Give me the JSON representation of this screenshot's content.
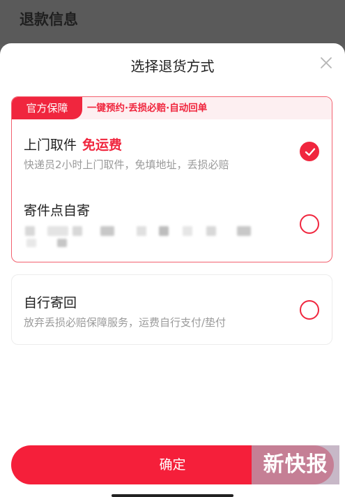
{
  "background": {
    "title": "退款信息"
  },
  "sheet": {
    "title": "选择退货方式"
  },
  "guarantee": {
    "tag": "官方保障",
    "tagline": "一键预约·丢损必赔·自动回单"
  },
  "options": [
    {
      "title": "上门取件",
      "highlight": "免运费",
      "desc": "快递员2小时上门取件，免填地址，丢损必赔",
      "checked": true
    },
    {
      "title": "寄件点自寄",
      "desc": "",
      "checked": false
    },
    {
      "title": "自行寄回",
      "desc": "放弃丢损必赔保障服务，运费自行支付/垫付",
      "checked": false
    }
  ],
  "confirm_label": "确定",
  "watermark": "新快报",
  "colors": {
    "accent": "#f0263e",
    "button": "#f51f3a"
  }
}
